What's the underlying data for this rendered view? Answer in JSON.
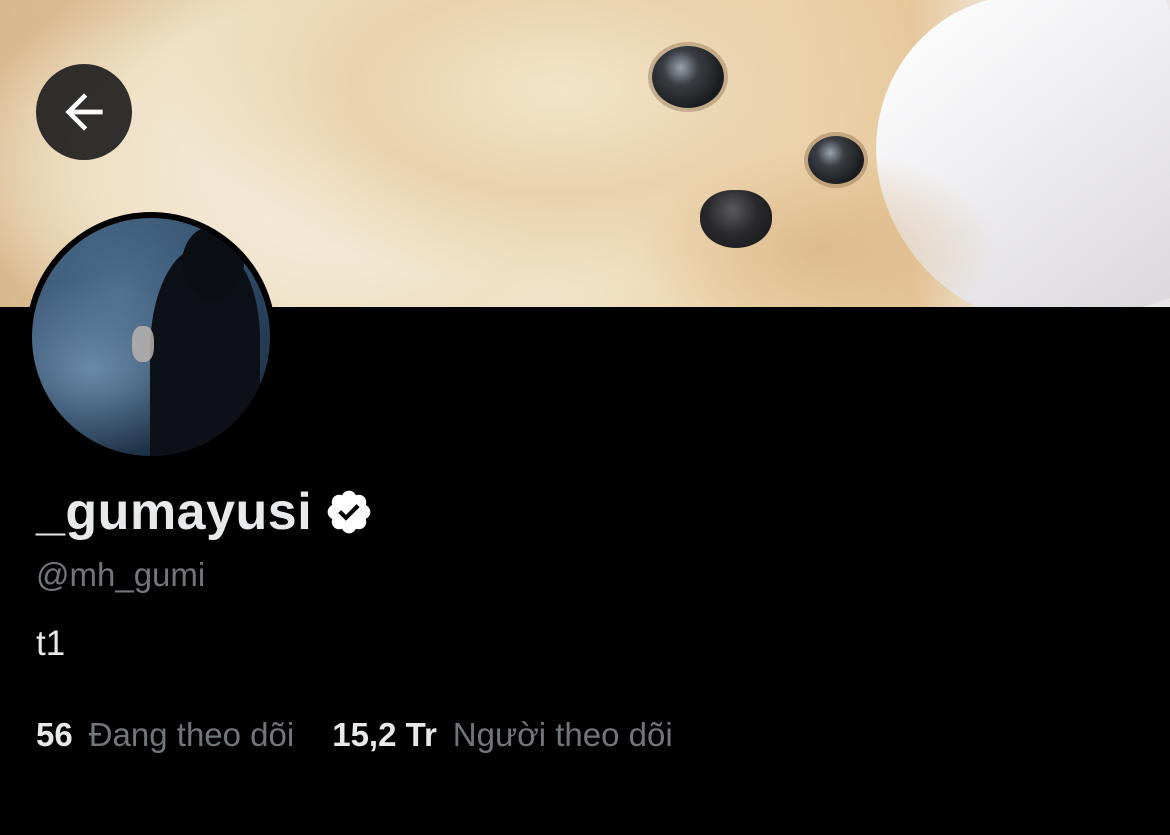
{
  "header": {
    "back_icon": "arrow-left-icon",
    "banner_image": "pomeranian dog photo"
  },
  "profile": {
    "display_name": "_gumayusi",
    "verified_icon": "verified-badge-icon",
    "handle": "@mh_gumi",
    "bio": "t1"
  },
  "stats": {
    "following_count": "56",
    "following_label": "Đang theo dõi",
    "followers_count": "15,2 Tr",
    "followers_label": "Người theo dõi"
  },
  "colors": {
    "background": "#000000",
    "primary_text": "#e7e9ea",
    "secondary_text": "#71767b"
  }
}
